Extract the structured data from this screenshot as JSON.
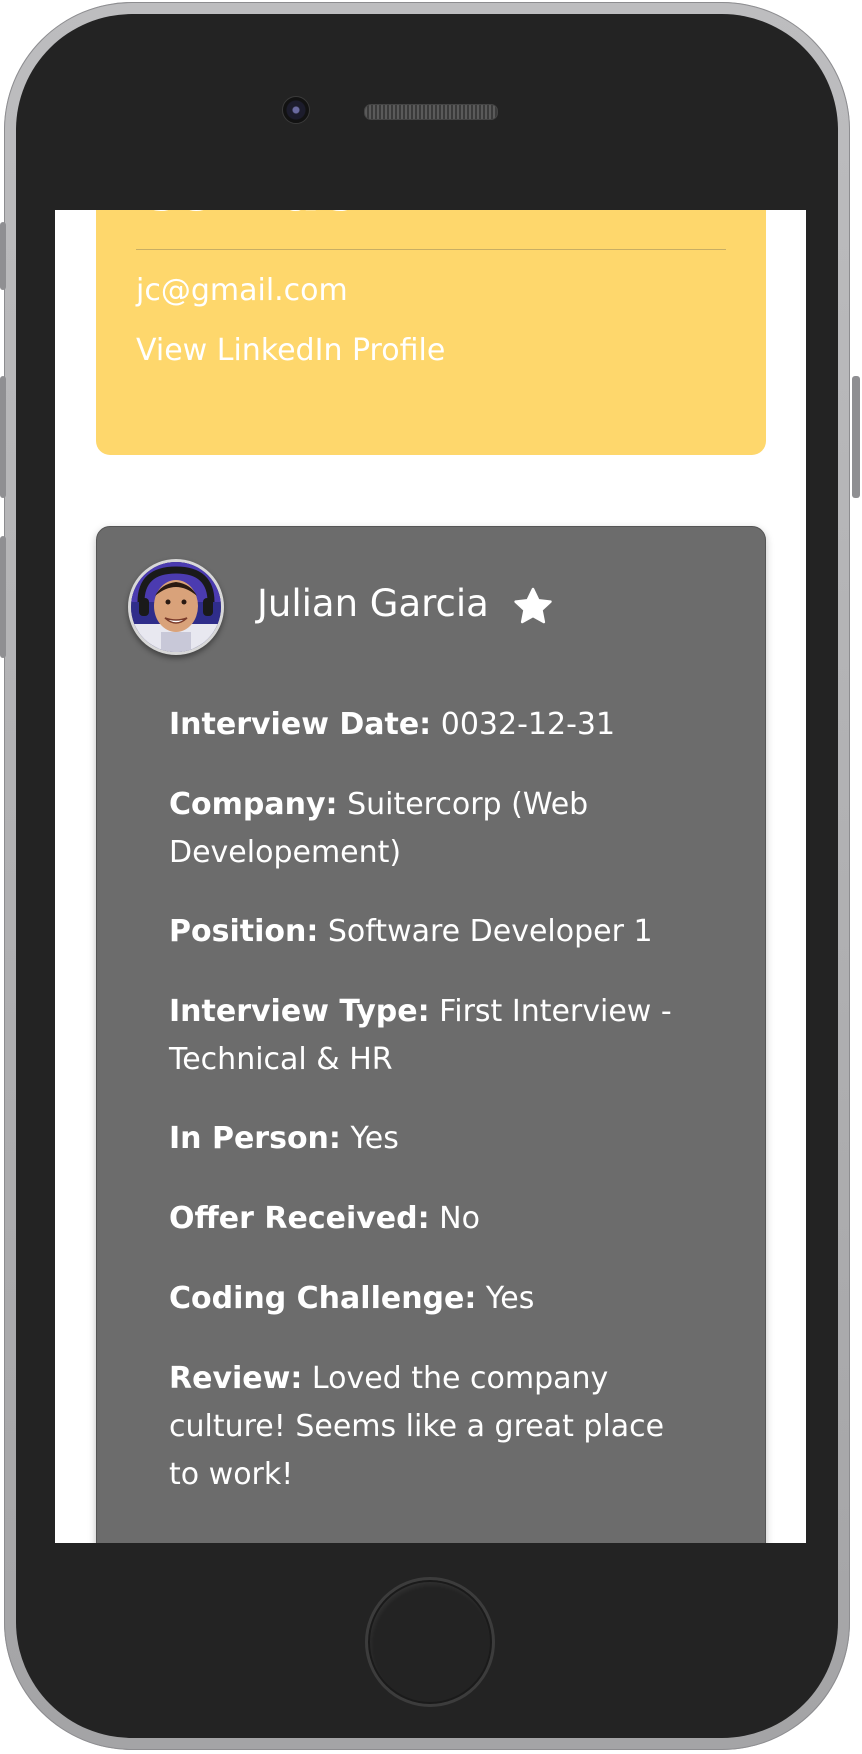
{
  "contact": {
    "heading": "Contact",
    "email": "jc@gmail.com",
    "linkedin_label": "View LinkedIn Profile",
    "background_color": "#fed76c"
  },
  "interview": {
    "name": "Julian Garcia",
    "favorite_icon": "star-icon",
    "card_color": "#6c6c6c",
    "details": [
      {
        "label": "Interview Date:",
        "value": "0032-12-31"
      },
      {
        "label": "Company:",
        "value": "Suitercorp (Web Developement)"
      },
      {
        "label": "Position:",
        "value": "Software Developer 1"
      },
      {
        "label": "Interview Type:",
        "value": "First Interview - Technical & HR"
      },
      {
        "label": "In Person:",
        "value": "Yes"
      },
      {
        "label": "Offer Received:",
        "value": "No"
      },
      {
        "label": "Coding Challenge:",
        "value": "Yes"
      },
      {
        "label": "Review:",
        "value": "Loved the company culture! Seems like a great place to work!"
      }
    ]
  }
}
